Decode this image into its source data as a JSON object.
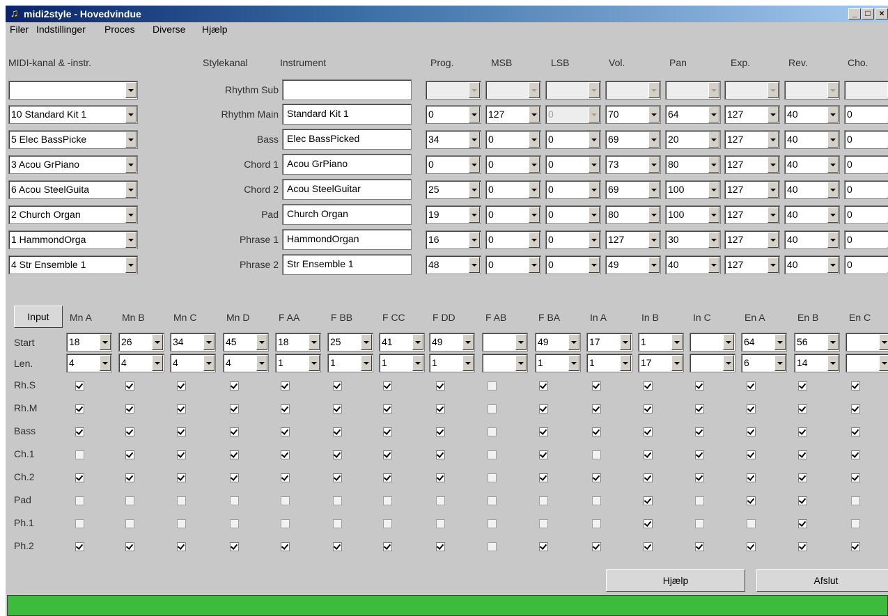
{
  "window": {
    "title": "midi2style - Hovedvindue",
    "status_text": ""
  },
  "menu": [
    "Filer",
    "Indstillinger",
    "Proces",
    "Diverse",
    "Hjælp"
  ],
  "headers": {
    "midi": "MIDI-kanal & -instr.",
    "stylekanal": "Stylekanal",
    "instrument": "Instrument",
    "params": [
      "Prog.",
      "MSB",
      "LSB",
      "Vol.",
      "Pan",
      "Exp.",
      "Rev.",
      "Cho."
    ]
  },
  "channels": [
    {
      "midi": "",
      "name": "Rhythm Sub",
      "instrument": "",
      "params": [
        "",
        "",
        "",
        "",
        "",
        "",
        "",
        ""
      ]
    },
    {
      "midi": "10 Standard Kit 1",
      "name": "Rhythm Main",
      "instrument": "Standard Kit 1",
      "params": [
        "0",
        "127",
        "0",
        "70",
        "64",
        "127",
        "40",
        "0"
      ]
    },
    {
      "midi": "5 Elec BassPicke",
      "name": "Bass",
      "instrument": "Elec BassPicked",
      "params": [
        "34",
        "0",
        "0",
        "69",
        "20",
        "127",
        "40",
        "0"
      ]
    },
    {
      "midi": "3 Acou GrPiano",
      "name": "Chord 1",
      "instrument": "Acou GrPiano",
      "params": [
        "0",
        "0",
        "0",
        "73",
        "80",
        "127",
        "40",
        "0"
      ]
    },
    {
      "midi": "6 Acou SteelGuita",
      "name": "Chord 2",
      "instrument": "Acou SteelGuitar",
      "params": [
        "25",
        "0",
        "0",
        "69",
        "100",
        "127",
        "40",
        "0"
      ]
    },
    {
      "midi": "2 Church Organ",
      "name": "Pad",
      "instrument": "Church Organ",
      "params": [
        "19",
        "0",
        "0",
        "80",
        "100",
        "127",
        "40",
        "0"
      ]
    },
    {
      "midi": "1 HammondOrga",
      "name": "Phrase 1",
      "instrument": "HammondOrgan",
      "params": [
        "16",
        "0",
        "0",
        "127",
        "30",
        "127",
        "40",
        "0"
      ]
    },
    {
      "midi": "4 Str Ensemble 1",
      "name": "Phrase 2",
      "instrument": "Str Ensemble 1",
      "params": [
        "48",
        "0",
        "0",
        "49",
        "40",
        "127",
        "40",
        "0"
      ]
    }
  ],
  "sections": {
    "input_button": "Input",
    "names": [
      "Mn A",
      "Mn B",
      "Mn C",
      "Mn D",
      "F AA",
      "F BB",
      "F CC",
      "F DD",
      "F AB",
      "F BA",
      "In A",
      "In B",
      "In C",
      "En A",
      "En B",
      "En C"
    ],
    "start_label": "Start",
    "len_label": "Len.",
    "start": [
      "18",
      "26",
      "34",
      "45",
      "18",
      "25",
      "41",
      "49",
      "",
      "49",
      "17",
      "1",
      "",
      "64",
      "56",
      ""
    ],
    "len": [
      "4",
      "4",
      "4",
      "4",
      "1",
      "1",
      "1",
      "1",
      "",
      "1",
      "1",
      "17",
      "",
      "6",
      "14",
      ""
    ]
  },
  "matrix": [
    {
      "label": "Rh.S",
      "checks": [
        1,
        1,
        1,
        1,
        1,
        1,
        1,
        1,
        0,
        1,
        1,
        1,
        1,
        1,
        1,
        1
      ]
    },
    {
      "label": "Rh.M",
      "checks": [
        1,
        1,
        1,
        1,
        1,
        1,
        1,
        1,
        0,
        1,
        1,
        1,
        1,
        1,
        1,
        1
      ]
    },
    {
      "label": "Bass",
      "checks": [
        1,
        1,
        1,
        1,
        1,
        1,
        1,
        1,
        0,
        1,
        1,
        1,
        1,
        1,
        1,
        1
      ]
    },
    {
      "label": "Ch.1",
      "checks": [
        0,
        1,
        1,
        1,
        1,
        1,
        1,
        1,
        0,
        1,
        0,
        1,
        1,
        1,
        1,
        1
      ]
    },
    {
      "label": "Ch.2",
      "checks": [
        1,
        1,
        1,
        1,
        1,
        1,
        1,
        1,
        0,
        1,
        1,
        1,
        1,
        1,
        1,
        1
      ]
    },
    {
      "label": "Pad",
      "checks": [
        0,
        0,
        0,
        0,
        0,
        0,
        0,
        0,
        0,
        0,
        0,
        1,
        0,
        1,
        1,
        0
      ]
    },
    {
      "label": "Ph.1",
      "checks": [
        0,
        0,
        0,
        0,
        0,
        0,
        0,
        0,
        0,
        0,
        0,
        1,
        0,
        0,
        1,
        0
      ]
    },
    {
      "label": "Ph.2",
      "checks": [
        1,
        1,
        1,
        1,
        1,
        1,
        1,
        1,
        0,
        1,
        1,
        1,
        1,
        1,
        1,
        1
      ]
    }
  ],
  "buttons": {
    "help": "Hjælp",
    "quit": "Afslut"
  }
}
